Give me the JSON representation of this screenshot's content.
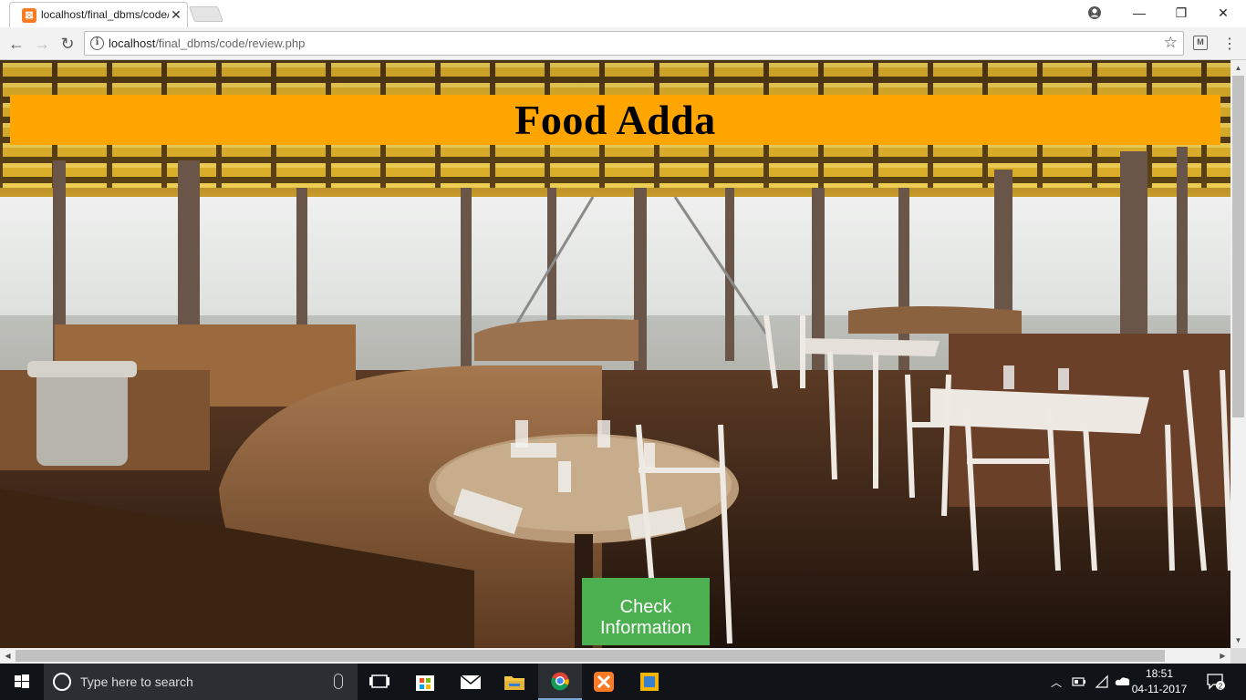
{
  "browser": {
    "tab": {
      "title": "localhost/final_dbms/code/review.php",
      "favicon_letter": "⊠"
    },
    "url": {
      "host": "localhost",
      "path": "/final_dbms/code/review.php"
    },
    "icons": [
      "back-icon",
      "forward-icon",
      "reload-icon",
      "info-icon",
      "star-icon",
      "extension-icon",
      "menu-icon",
      "profile-icon"
    ]
  },
  "page": {
    "title": "Food Adda",
    "button_label": "Check Information",
    "background": "restaurant-interior-photo",
    "colors": {
      "banner": "#ffa500",
      "button": "#4caf50"
    }
  },
  "taskbar": {
    "search_placeholder": "Type here to search",
    "time": "18:51",
    "date": "04-11-2017",
    "notification_count": "2"
  }
}
